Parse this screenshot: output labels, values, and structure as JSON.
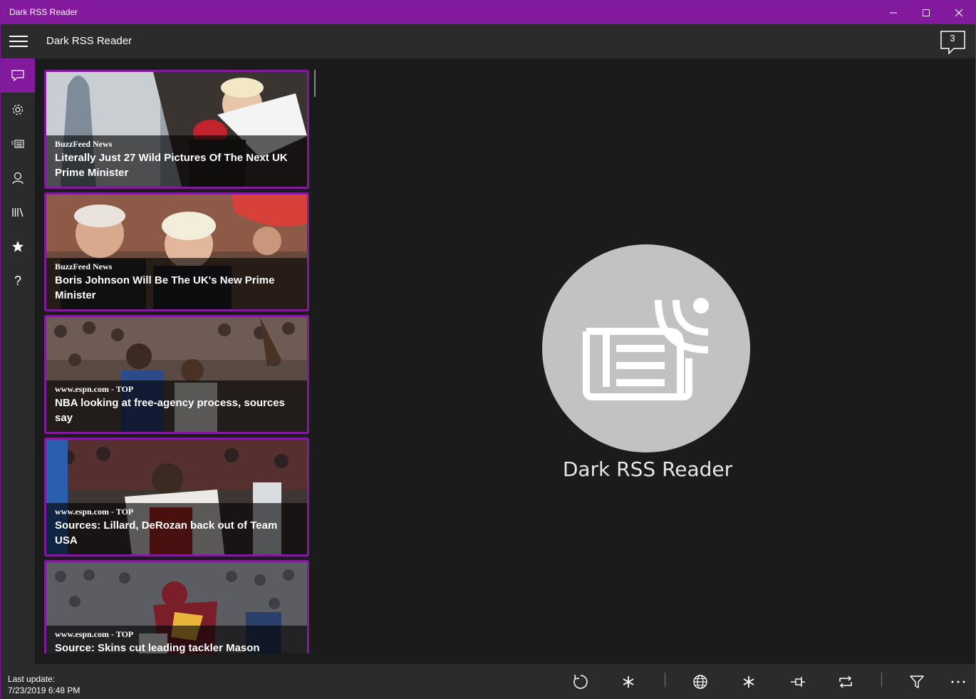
{
  "window": {
    "title": "Dark RSS Reader",
    "accent_color": "#831a9e",
    "controls": [
      "minimize-icon",
      "maximize-icon",
      "close-icon"
    ]
  },
  "header": {
    "title": "Dark RSS Reader",
    "notification_count": "3"
  },
  "sidebar": {
    "items": [
      {
        "icon": "feed-icon",
        "active": true
      },
      {
        "icon": "gear-icon",
        "active": false
      },
      {
        "icon": "news-list-icon",
        "active": false
      },
      {
        "icon": "person-icon",
        "active": false
      },
      {
        "icon": "library-icon",
        "active": false
      },
      {
        "icon": "star-icon",
        "active": false
      },
      {
        "icon": "help-icon",
        "active": false
      }
    ]
  },
  "articles": [
    {
      "source": "BuzzFeed News",
      "title": "Literally Just 27 Wild Pictures Of The Next UK Prime Minister"
    },
    {
      "source": "BuzzFeed News",
      "title": "Boris Johnson Will Be The UK's New Prime Minister"
    },
    {
      "source": "www.espn.com - TOP",
      "title": "NBA looking at free-agency process, sources say"
    },
    {
      "source": "www.espn.com - TOP",
      "title": "Sources: Lillard, DeRozan back out of Team USA"
    },
    {
      "source": "www.espn.com - TOP",
      "title": "Source: Skins cut leading tackler Mason"
    }
  ],
  "placeholder": {
    "label": "Dark RSS Reader",
    "icon": "rss-newspaper-icon"
  },
  "status": {
    "last_update_label": "Last update:",
    "last_update_value": "7/23/2019 6:48 PM"
  },
  "commands": [
    "refresh-icon",
    "asterisk-icon",
    "globe-icon",
    "asterisk-icon",
    "pin-icon",
    "repeat-icon",
    "filter-icon",
    "more-icon"
  ]
}
